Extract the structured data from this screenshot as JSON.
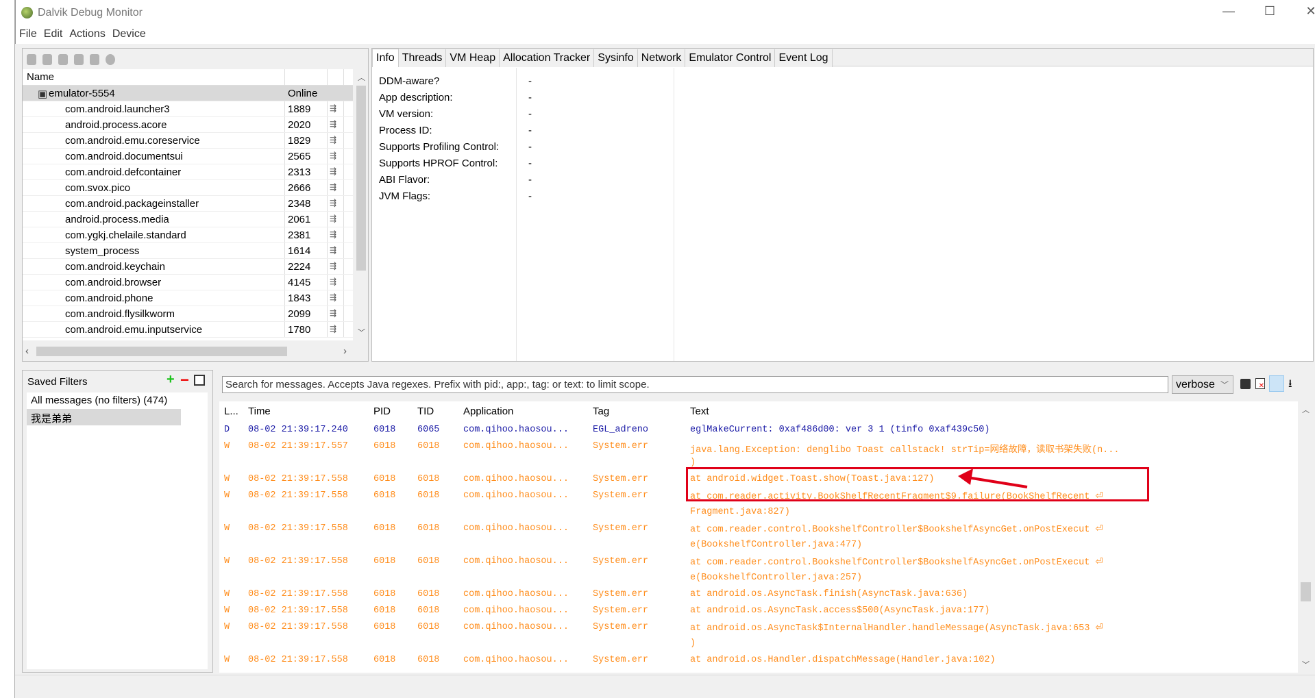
{
  "window": {
    "title": "Dalvik Debug Monitor",
    "minimize": "—",
    "maximize": "☐",
    "close": "✕"
  },
  "menu": [
    "File",
    "Edit",
    "Actions",
    "Device"
  ],
  "devices": {
    "header": {
      "name": "Name"
    },
    "device": {
      "name": "emulator-5554",
      "status": "Online"
    },
    "processes": [
      {
        "name": "com.android.launcher3",
        "pid": "1889"
      },
      {
        "name": "android.process.acore",
        "pid": "2020"
      },
      {
        "name": "com.android.emu.coreservice",
        "pid": "1829"
      },
      {
        "name": "com.android.documentsui",
        "pid": "2565"
      },
      {
        "name": "com.android.defcontainer",
        "pid": "2313"
      },
      {
        "name": "com.svox.pico",
        "pid": "2666"
      },
      {
        "name": "com.android.packageinstaller",
        "pid": "2348"
      },
      {
        "name": "android.process.media",
        "pid": "2061"
      },
      {
        "name": "com.ygkj.chelaile.standard",
        "pid": "2381"
      },
      {
        "name": "system_process",
        "pid": "1614"
      },
      {
        "name": "com.android.keychain",
        "pid": "2224"
      },
      {
        "name": "com.android.browser",
        "pid": "4145"
      },
      {
        "name": "com.android.phone",
        "pid": "1843"
      },
      {
        "name": "com.android.flysilkworm",
        "pid": "2099"
      },
      {
        "name": "com.android.emu.inputservice",
        "pid": "1780"
      }
    ]
  },
  "tabs": [
    "Info",
    "Threads",
    "VM Heap",
    "Allocation Tracker",
    "Sysinfo",
    "Network",
    "Emulator Control",
    "Event Log"
  ],
  "info": [
    {
      "label": "DDM-aware?",
      "value": "-"
    },
    {
      "label": "App description:",
      "value": "-"
    },
    {
      "label": "VM version:",
      "value": "-"
    },
    {
      "label": "Process ID:",
      "value": "-"
    },
    {
      "label": "Supports Profiling Control:",
      "value": "-"
    },
    {
      "label": "Supports HPROF Control:",
      "value": "-"
    },
    {
      "label": "ABI Flavor:",
      "value": "-"
    },
    {
      "label": "JVM Flags:",
      "value": "-"
    }
  ],
  "filters": {
    "title": "Saved Filters",
    "add": "+",
    "remove": "−",
    "items": [
      "All messages (no filters) (474)",
      "我是弟弟"
    ]
  },
  "logcat": {
    "search_placeholder": "Search for messages. Accepts Java regexes. Prefix with pid:, app:, tag: or text: to limit scope.",
    "level_select": "verbose",
    "columns": [
      "L...",
      "Time",
      "PID",
      "TID",
      "Application",
      "Tag",
      "Text"
    ],
    "colors": {
      "D": "#1a1aa6",
      "W": "#ff8c1a",
      "highlight": "#e00018"
    },
    "rows": [
      {
        "level": "D",
        "time": "08-02 21:39:17.240",
        "pid": "6018",
        "tid": "6065",
        "app": "com.qihoo.haosou...",
        "tag": "EGL_adreno",
        "text": "eglMakeCurrent: 0xaf486d00: ver 3 1 (tinfo 0xaf439c50)"
      },
      {
        "level": "W",
        "time": "08-02 21:39:17.557",
        "pid": "6018",
        "tid": "6018",
        "app": "com.qihoo.haosou...",
        "tag": "System.err",
        "text": "java.lang.Exception: denglibo Toast callstack! strTip=网络故障，读取书架失败(n..."
      },
      {
        "level": "W",
        "time": "",
        "pid": "",
        "tid": "",
        "app": "",
        "tag": "",
        "text": ")"
      },
      {
        "level": "W",
        "time": "08-02 21:39:17.558",
        "pid": "6018",
        "tid": "6018",
        "app": "com.qihoo.haosou...",
        "tag": "System.err",
        "text": "at android.widget.Toast.show(Toast.java:127)"
      },
      {
        "level": "W",
        "time": "08-02 21:39:17.558",
        "pid": "6018",
        "tid": "6018",
        "app": "com.qihoo.haosou...",
        "tag": "System.err",
        "text": "at com.reader.activity.BookShelfRecentFragment$9.failure(BookShelfRecent ⏎"
      },
      {
        "level": "W",
        "time": "",
        "pid": "",
        "tid": "",
        "app": "",
        "tag": "",
        "text": "Fragment.java:827)"
      },
      {
        "level": "W",
        "time": "08-02 21:39:17.558",
        "pid": "6018",
        "tid": "6018",
        "app": "com.qihoo.haosou...",
        "tag": "System.err",
        "text": "at com.reader.control.BookshelfController$BookshelfAsyncGet.onPostExecut ⏎"
      },
      {
        "level": "W",
        "time": "",
        "pid": "",
        "tid": "",
        "app": "",
        "tag": "",
        "text": "e(BookshelfController.java:477)"
      },
      {
        "level": "W",
        "time": "08-02 21:39:17.558",
        "pid": "6018",
        "tid": "6018",
        "app": "com.qihoo.haosou...",
        "tag": "System.err",
        "text": "at com.reader.control.BookshelfController$BookshelfAsyncGet.onPostExecut ⏎"
      },
      {
        "level": "W",
        "time": "",
        "pid": "",
        "tid": "",
        "app": "",
        "tag": "",
        "text": "e(BookshelfController.java:257)"
      },
      {
        "level": "W",
        "time": "08-02 21:39:17.558",
        "pid": "6018",
        "tid": "6018",
        "app": "com.qihoo.haosou...",
        "tag": "System.err",
        "text": "at android.os.AsyncTask.finish(AsyncTask.java:636)"
      },
      {
        "level": "W",
        "time": "08-02 21:39:17.558",
        "pid": "6018",
        "tid": "6018",
        "app": "com.qihoo.haosou...",
        "tag": "System.err",
        "text": "at android.os.AsyncTask.access$500(AsyncTask.java:177)"
      },
      {
        "level": "W",
        "time": "08-02 21:39:17.558",
        "pid": "6018",
        "tid": "6018",
        "app": "com.qihoo.haosou...",
        "tag": "System.err",
        "text": "at android.os.AsyncTask$InternalHandler.handleMessage(AsyncTask.java:653 ⏎"
      },
      {
        "level": "W",
        "time": "",
        "pid": "",
        "tid": "",
        "app": "",
        "tag": "",
        "text": ")"
      },
      {
        "level": "W",
        "time": "08-02 21:39:17.558",
        "pid": "6018",
        "tid": "6018",
        "app": "com.qihoo.haosou...",
        "tag": "System.err",
        "text": "at android.os.Handler.dispatchMessage(Handler.java:102)"
      }
    ]
  }
}
